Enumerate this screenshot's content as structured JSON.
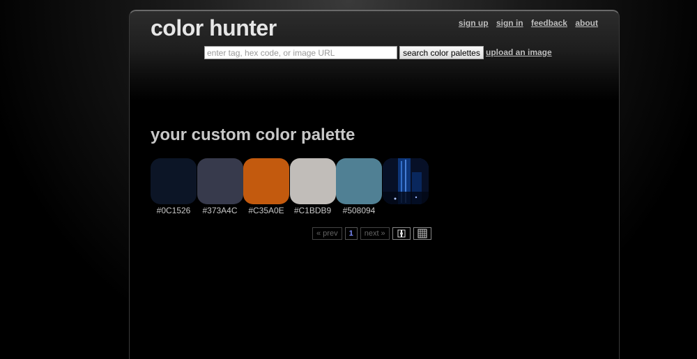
{
  "logo": "color hunter",
  "nav": [
    {
      "label": "sign up"
    },
    {
      "label": "sign in"
    },
    {
      "label": "feedback"
    },
    {
      "label": "about"
    }
  ],
  "search": {
    "placeholder": "enter tag, hex code, or image URL",
    "value": "",
    "button_label": "search color palettes",
    "upload_label": "upload an image"
  },
  "section_title": "your custom color palette",
  "palette": [
    {
      "hex": "#0C1526",
      "label": "#0C1526"
    },
    {
      "hex": "#373A4C",
      "label": "#373A4C"
    },
    {
      "hex": "#C35A0E",
      "label": "#C35A0E"
    },
    {
      "hex": "#C1BDB9",
      "label": "#C1BDB9"
    },
    {
      "hex": "#508094",
      "label": "#508094"
    }
  ],
  "pager": {
    "prev_label": "« prev",
    "page": "1",
    "next_label": "next »"
  }
}
